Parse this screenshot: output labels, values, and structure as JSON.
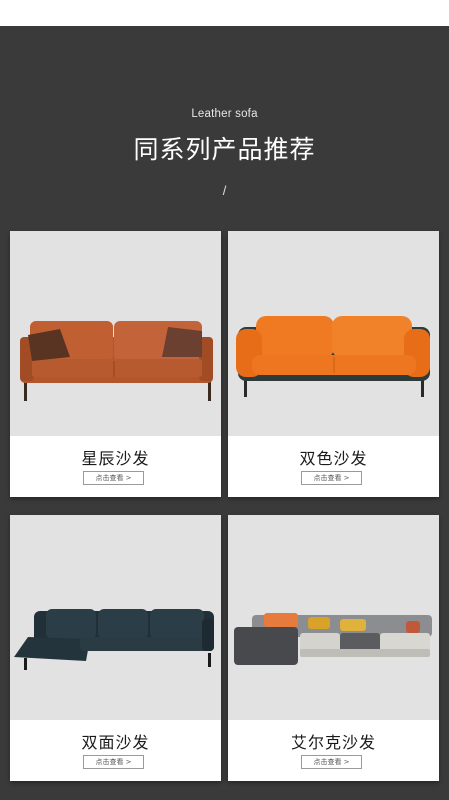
{
  "header": {
    "subtitle": "Leather sofa",
    "title": "同系列产品推荐",
    "separator": "/"
  },
  "colors": {
    "background": "#3a3a3a",
    "card": "#ffffff",
    "image_bg": "#e2e2e2"
  },
  "products": [
    {
      "name": "星辰沙发",
      "button_label": "点击查看 >",
      "image": "orange-leather-sofa"
    },
    {
      "name": "双色沙发",
      "button_label": "点击查看 >",
      "image": "orange-two-tone-sofa"
    },
    {
      "name": "双面沙发",
      "button_label": "点击查看 >",
      "image": "dark-teal-sectional-sofa"
    },
    {
      "name": "艾尔克沙发",
      "button_label": "点击查看 >",
      "image": "grey-modular-sectional-sofa"
    }
  ]
}
